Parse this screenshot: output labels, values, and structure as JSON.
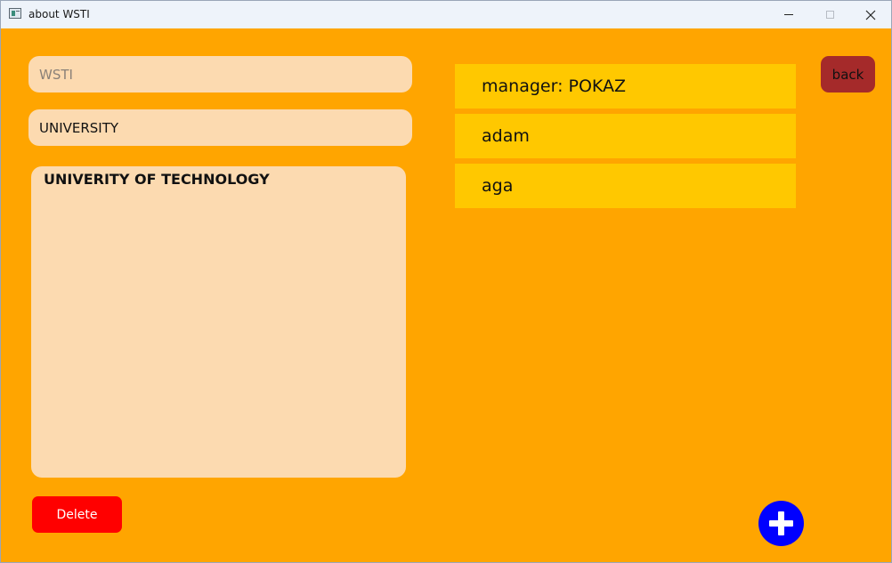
{
  "window": {
    "title": "about WSTI",
    "controls": {
      "minimize": "minimize-icon",
      "maximize": "maximize-icon",
      "close": "close-icon"
    }
  },
  "form": {
    "name_input": {
      "value": "",
      "placeholder": "WSTI"
    },
    "type_input": {
      "value": "UNIVERSITY"
    },
    "description": {
      "value": "UNIVERITY OF TECHNOLOGY"
    },
    "delete_label": "Delete"
  },
  "list": {
    "items": [
      {
        "label": "manager: POKAZ"
      },
      {
        "label": "adam"
      },
      {
        "label": "aga"
      }
    ]
  },
  "back_label": "back",
  "add_icon": "plus-icon",
  "colors": {
    "background": "#ffa500",
    "field": "#fcdab0",
    "list_item": "#ffc800",
    "delete": "#ff0000",
    "back": "#a52a2a",
    "add": "#0000ff"
  }
}
